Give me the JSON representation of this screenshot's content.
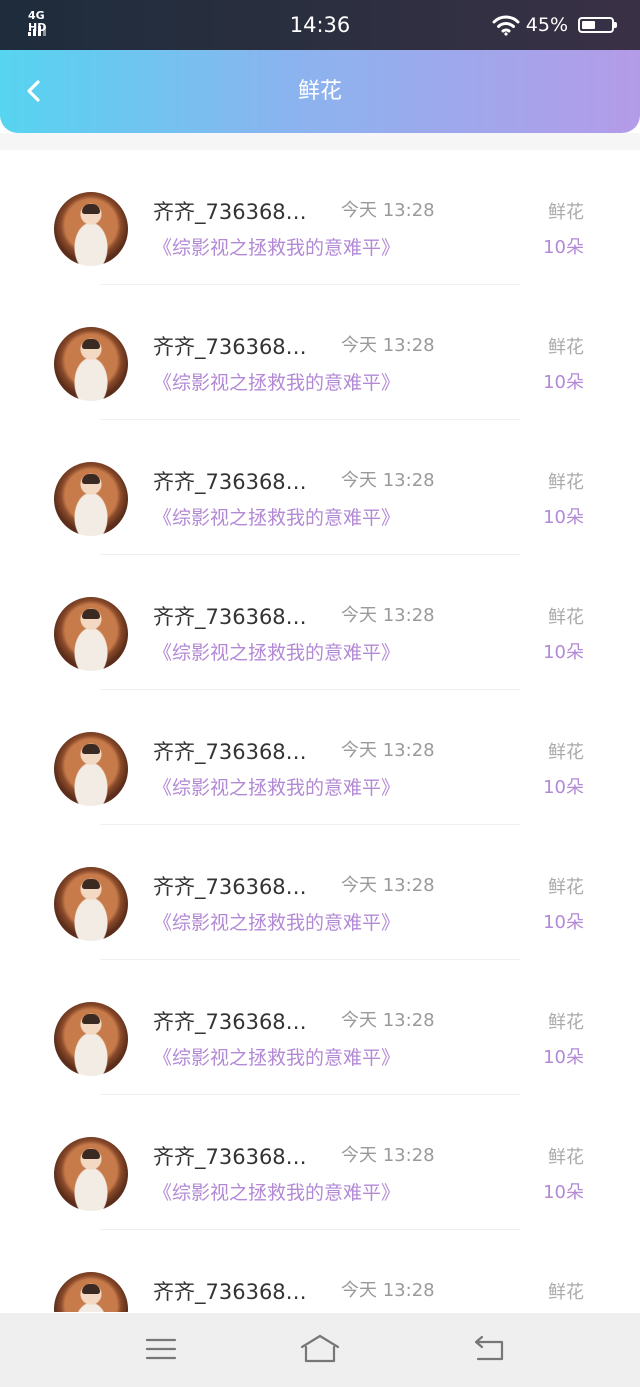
{
  "status_bar": {
    "network": "4G HD",
    "time": "14:36",
    "battery_percent": "45%",
    "battery_level": 0.45
  },
  "header": {
    "title": "鲜花"
  },
  "list": {
    "items": [
      {
        "username": "齐齐_736368…",
        "time": "今天 13:28",
        "book": "《综影视之拯救我的意难平》",
        "gift_label": "鲜花",
        "gift_count": "10朵"
      },
      {
        "username": "齐齐_736368…",
        "time": "今天 13:28",
        "book": "《综影视之拯救我的意难平》",
        "gift_label": "鲜花",
        "gift_count": "10朵"
      },
      {
        "username": "齐齐_736368…",
        "time": "今天 13:28",
        "book": "《综影视之拯救我的意难平》",
        "gift_label": "鲜花",
        "gift_count": "10朵"
      },
      {
        "username": "齐齐_736368…",
        "time": "今天 13:28",
        "book": "《综影视之拯救我的意难平》",
        "gift_label": "鲜花",
        "gift_count": "10朵"
      },
      {
        "username": "齐齐_736368…",
        "time": "今天 13:28",
        "book": "《综影视之拯救我的意难平》",
        "gift_label": "鲜花",
        "gift_count": "10朵"
      },
      {
        "username": "齐齐_736368…",
        "time": "今天 13:28",
        "book": "《综影视之拯救我的意难平》",
        "gift_label": "鲜花",
        "gift_count": "10朵"
      },
      {
        "username": "齐齐_736368…",
        "time": "今天 13:28",
        "book": "《综影视之拯救我的意难平》",
        "gift_label": "鲜花",
        "gift_count": "10朵"
      },
      {
        "username": "齐齐_736368…",
        "time": "今天 13:28",
        "book": "《综影视之拯救我的意难平》",
        "gift_label": "鲜花",
        "gift_count": "10朵"
      },
      {
        "username": "齐齐_736368…",
        "time": "今天 13:28",
        "book": "",
        "gift_label": "鲜花",
        "gift_count": ""
      }
    ]
  },
  "icons": {
    "back": "chevron-left-icon",
    "menu": "menu-icon",
    "home": "home-icon",
    "return": "return-icon",
    "wifi": "wifi-icon",
    "battery": "battery-icon",
    "signal": "signal-icon"
  },
  "colors": {
    "accent": "#b389d6",
    "header_start": "#56d4f0",
    "header_end": "#b49be8"
  }
}
